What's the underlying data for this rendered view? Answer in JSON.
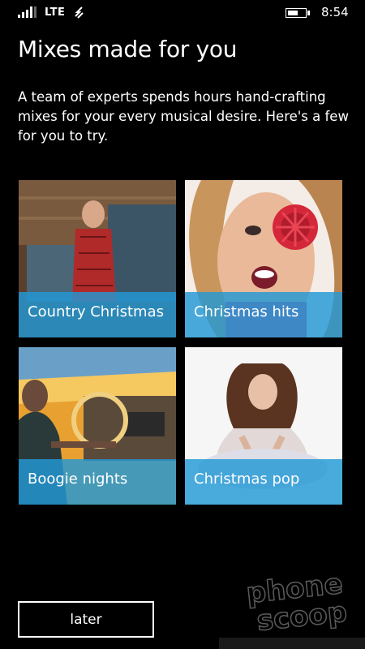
{
  "status_bar": {
    "network": "LTE",
    "time": "8:54",
    "icons": [
      "signal-icon",
      "data-sync-icon",
      "battery-icon"
    ]
  },
  "title": "Mixes made for you",
  "description": "A team of experts spends hours hand-crafting mixes for your every musical desire. Here's a few for you to try.",
  "mixes": [
    {
      "label": "Country Christmas"
    },
    {
      "label": "Christmas hits"
    },
    {
      "label": "Boogie nights"
    },
    {
      "label": "Christmas pop"
    }
  ],
  "later_label": "later",
  "watermark": "phone scoop",
  "colors": {
    "background": "#000000",
    "accent": "#2298d6",
    "text": "#ffffff"
  }
}
